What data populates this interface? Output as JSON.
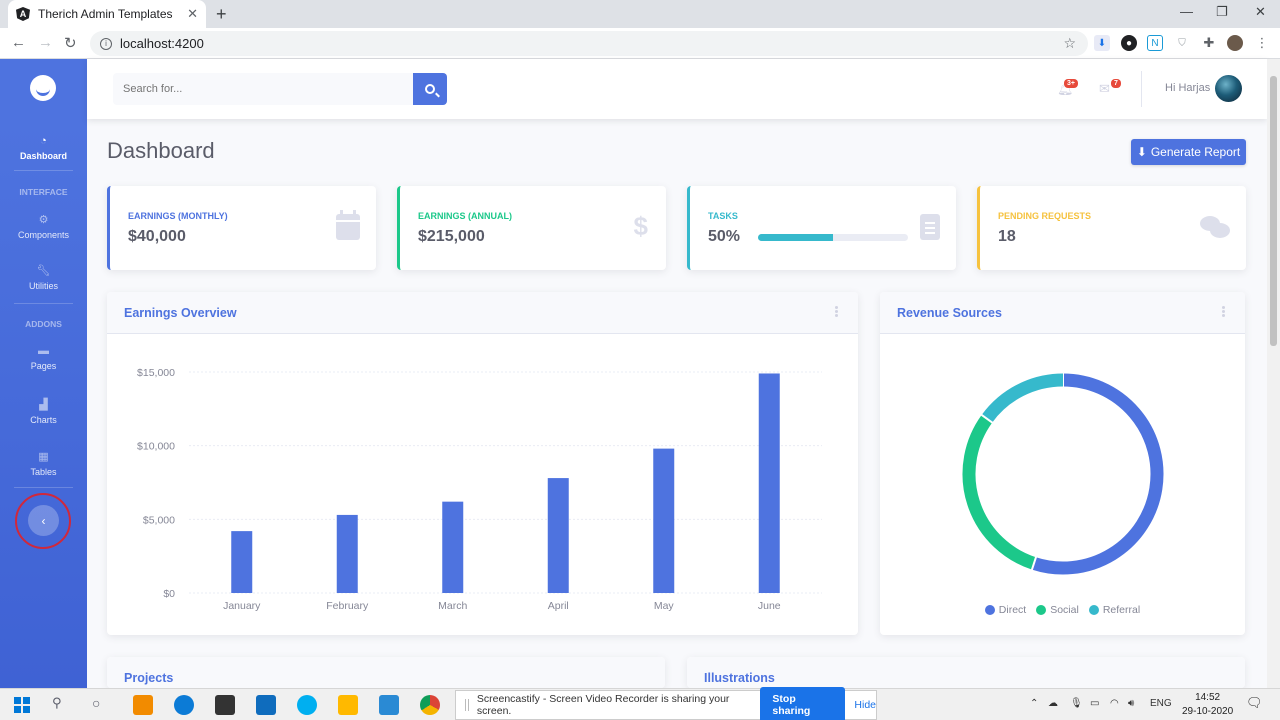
{
  "browser": {
    "tab_title": "Therich Admin Templates",
    "tab_favicon_letter": "A",
    "new_tab_label": "+",
    "url": "localhost:4200"
  },
  "sidebar": {
    "active_item": {
      "label": "Dashboard",
      "icon": "gauge-icon"
    },
    "heading_interface": "INTERFACE",
    "interface_items": [
      {
        "label": "Components",
        "icon": "cog-icon"
      },
      {
        "label": "Utilities",
        "icon": "wrench-icon"
      }
    ],
    "heading_addons": "ADDONS",
    "addon_items": [
      {
        "label": "Pages",
        "icon": "folder-icon"
      },
      {
        "label": "Charts",
        "icon": "chart-area-icon"
      },
      {
        "label": "Tables",
        "icon": "table-icon"
      }
    ],
    "toggle_icon": "chevron-left-icon"
  },
  "topbar": {
    "search_placeholder": "Search for...",
    "alerts_badge": "3+",
    "messages_badge": "7",
    "user_greeting": "Hi Harjas"
  },
  "page": {
    "title": "Dashboard",
    "report_button": "Generate Report"
  },
  "stats": [
    {
      "label": "EARNINGS (MONTHLY)",
      "value": "$40,000",
      "color": "#4e73df",
      "icon": "calendar-icon"
    },
    {
      "label": "EARNINGS (ANNUAL)",
      "value": "$215,000",
      "color": "#1cc88a",
      "icon": "dollar-icon"
    },
    {
      "label": "TASKS",
      "value": "50%",
      "color": "#36b9cc",
      "icon": "clipboard-list-icon",
      "progress": 0.5
    },
    {
      "label": "PENDING REQUESTS",
      "value": "18",
      "color": "#f6c23e",
      "icon": "comments-icon"
    }
  ],
  "panels": {
    "earnings_title": "Earnings Overview",
    "revenue_title": "Revenue Sources",
    "projects_title": "Projects",
    "illustrations_title": "Illustrations"
  },
  "chart_data": [
    {
      "type": "bar",
      "categories": [
        "January",
        "February",
        "March",
        "April",
        "May",
        "June"
      ],
      "values": [
        4200,
        5300,
        6200,
        7800,
        9800,
        14900
      ],
      "yticks": [
        "$0",
        "$5,000",
        "$10,000",
        "$15,000"
      ],
      "ylim": [
        0,
        15000
      ],
      "color": "#4e73df",
      "grid": true
    },
    {
      "type": "pie",
      "labels": [
        "Direct",
        "Social",
        "Referral"
      ],
      "values": [
        55,
        30,
        15
      ],
      "colors": [
        "#4e73df",
        "#1cc88a",
        "#36b9cc"
      ],
      "legend_position": "bottom"
    }
  ],
  "sharebar": {
    "message": "Screencastify - Screen Video Recorder is sharing your screen.",
    "stop_label": "Stop sharing",
    "hide_label": "Hide"
  },
  "taskbar": {
    "language": "ENG",
    "time": "14:52",
    "date": "29-10-2020"
  }
}
